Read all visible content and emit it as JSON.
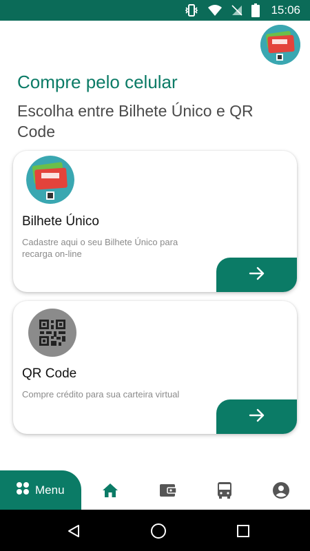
{
  "status_bar": {
    "time": "15:06",
    "icons": [
      "vibrate-icon",
      "wifi-icon",
      "no-sim-icon",
      "battery-icon"
    ]
  },
  "header": {
    "logo_icon": "bilhete-unico-logo-icon"
  },
  "main": {
    "title": "Compre pelo celular",
    "subtitle": "Escolha entre Bilhete Único e QR Code"
  },
  "cards": [
    {
      "title": "Bilhete Único",
      "description": "Cadastre aqui o seu Bilhete Único para recarga on-line",
      "image_icon": "bilhete-unico-card-icon",
      "button_icon": "arrow-right-icon"
    },
    {
      "title": "QR Code",
      "description": "Compre crédito para sua carteira virtual",
      "image_icon": "qr-code-icon",
      "button_icon": "arrow-right-icon"
    }
  ],
  "bottom_nav": {
    "menu_label": "Menu",
    "items": [
      "home-icon",
      "wallet-icon",
      "bus-icon",
      "account-icon"
    ]
  },
  "system_nav": [
    "back-icon",
    "home-circle-icon",
    "recents-icon"
  ],
  "colors": {
    "primary": "#0b7b66",
    "status_bar": "#0b6b58",
    "heading": "#0b7b66",
    "subtitle": "#4a4a4a",
    "muted": "#8a8a8a"
  }
}
